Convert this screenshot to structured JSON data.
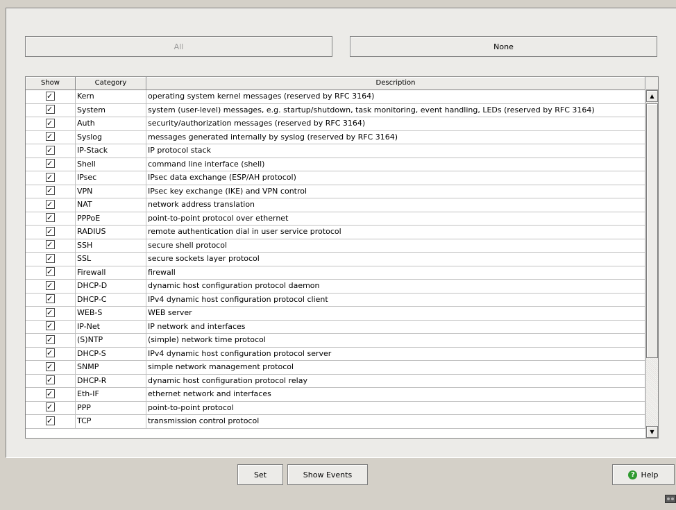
{
  "toolbar": {
    "all_label": "All",
    "none_label": "None"
  },
  "table": {
    "headers": {
      "show": "Show",
      "category": "Category",
      "description": "Description"
    },
    "rows": [
      {
        "show": true,
        "category": "Kern",
        "description": "operating system kernel messages (reserved by RFC 3164)"
      },
      {
        "show": true,
        "category": "System",
        "description": "system (user-level) messages, e.g. startup/shutdown, task monitoring, event handling, LEDs (reserved by RFC 3164)"
      },
      {
        "show": true,
        "category": "Auth",
        "description": "security/authorization messages (reserved by RFC 3164)"
      },
      {
        "show": true,
        "category": "Syslog",
        "description": "messages generated internally by syslog (reserved by RFC 3164)"
      },
      {
        "show": true,
        "category": "IP-Stack",
        "description": "IP protocol stack"
      },
      {
        "show": true,
        "category": "Shell",
        "description": "command line interface (shell)"
      },
      {
        "show": true,
        "category": "IPsec",
        "description": "IPsec data exchange (ESP/AH protocol)"
      },
      {
        "show": true,
        "category": "VPN",
        "description": "IPsec key exchange (IKE) and VPN control"
      },
      {
        "show": true,
        "category": "NAT",
        "description": "network address translation"
      },
      {
        "show": true,
        "category": "PPPoE",
        "description": "point-to-point protocol over ethernet"
      },
      {
        "show": true,
        "category": "RADIUS",
        "description": "remote authentication dial in user service protocol"
      },
      {
        "show": true,
        "category": "SSH",
        "description": "secure shell protocol"
      },
      {
        "show": true,
        "category": "SSL",
        "description": "secure sockets layer protocol"
      },
      {
        "show": true,
        "category": "Firewall",
        "description": "firewall"
      },
      {
        "show": true,
        "category": "DHCP-D",
        "description": "dynamic host configuration protocol daemon"
      },
      {
        "show": true,
        "category": "DHCP-C",
        "description": "IPv4 dynamic host configuration protocol client"
      },
      {
        "show": true,
        "category": "WEB-S",
        "description": "WEB server"
      },
      {
        "show": true,
        "category": "IP-Net",
        "description": "IP network and interfaces"
      },
      {
        "show": true,
        "category": "(S)NTP",
        "description": "(simple) network time protocol"
      },
      {
        "show": true,
        "category": "DHCP-S",
        "description": "IPv4 dynamic host configuration protocol server"
      },
      {
        "show": true,
        "category": "SNMP",
        "description": "simple network management protocol"
      },
      {
        "show": true,
        "category": "DHCP-R",
        "description": "dynamic host configuration protocol relay"
      },
      {
        "show": true,
        "category": "Eth-IF",
        "description": "ethernet network and interfaces"
      },
      {
        "show": true,
        "category": "PPP",
        "description": "point-to-point protocol"
      },
      {
        "show": true,
        "category": "TCP",
        "description": "transmission control protocol"
      }
    ]
  },
  "footer": {
    "set_label": "Set",
    "show_events_label": "Show Events",
    "help_label": "Help"
  }
}
